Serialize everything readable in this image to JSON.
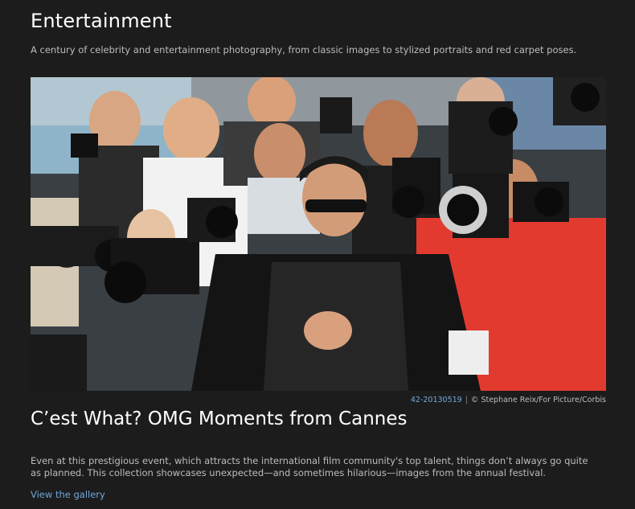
{
  "section": {
    "title": "Entertainment",
    "description": "A century of celebrity and entertainment photography, from classic images to stylized portraits and red carpet poses."
  },
  "photo": {
    "image_id": "42-20130519",
    "separator": "|",
    "credit": "© Stephane Reix/For Picture/Corbis"
  },
  "story": {
    "title": "C’est What? OMG Moments from Cannes",
    "body": "Even at this prestigious event, which attracts the international film community's top talent, things don’t always go quite as planned. This collection showcases unexpected—and sometimes hilarious—images from the annual festival.",
    "link_label": "View the gallery"
  }
}
